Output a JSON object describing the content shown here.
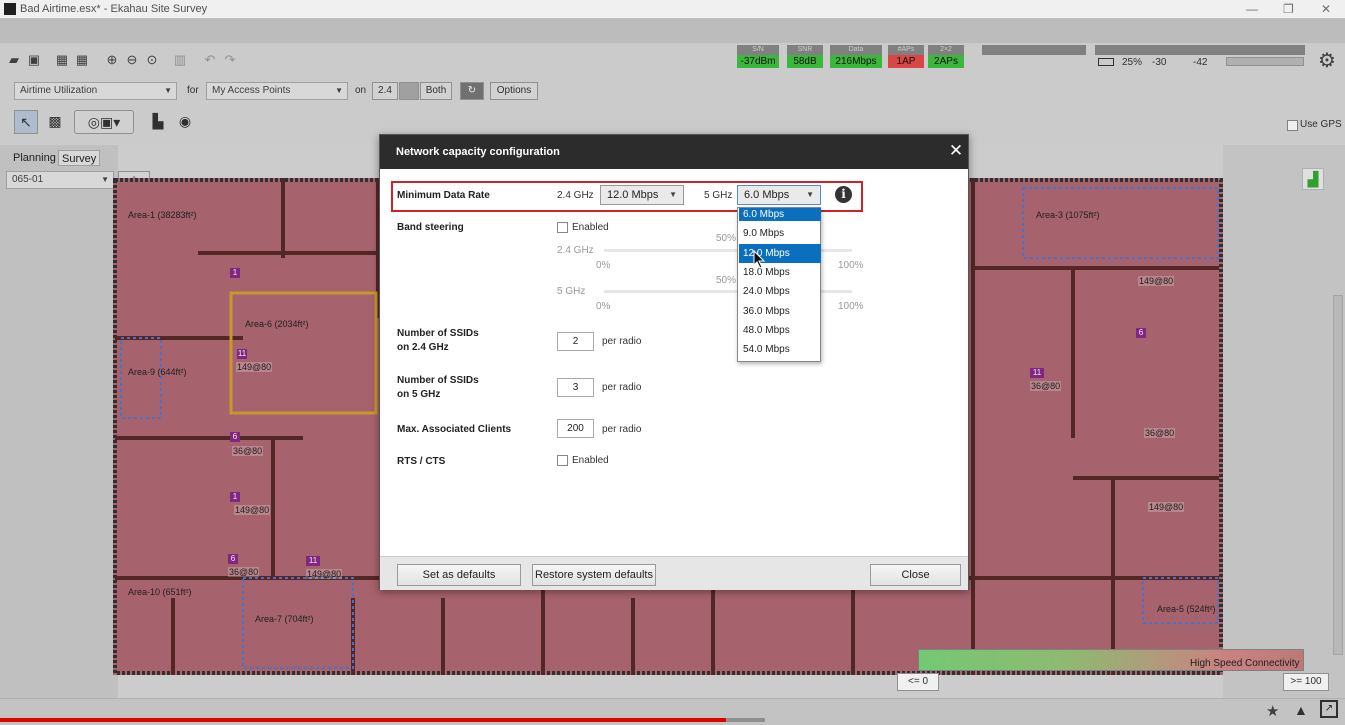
{
  "window": {
    "title": "Bad Airtime.esx* - Ekahau Site Survey",
    "min": "—",
    "max": "❐",
    "close": "✕"
  },
  "stats": [
    {
      "label": "S/N",
      "value": "-37dBm",
      "color": "#3fc43f"
    },
    {
      "label": "SNR",
      "value": "58dB",
      "color": "#3fc43f"
    },
    {
      "label": "Data",
      "value": "216Mbps",
      "color": "#3fc43f"
    },
    {
      "label": "#APs",
      "value": "1AP",
      "color": "#e84a4a"
    },
    {
      "label": "2×2",
      "value": "2APs",
      "color": "#3fc43f"
    }
  ],
  "status_right": {
    "battery": "25%",
    "sig24": "-30",
    "sig5": "-42"
  },
  "toolbar": {
    "view": "Airtime Utilization",
    "for_label": "for",
    "aps": "My Access Points",
    "on_label": "on",
    "band": "2.4",
    "band_both": "Both",
    "options": "Options"
  },
  "use_gps": "Use GPS",
  "tabs": {
    "planning": "Planning",
    "survey": "Survey"
  },
  "floor": "065-01",
  "areas": [
    {
      "label": "Area-1 (38283ft²)"
    },
    {
      "label": "Area-3 (1075ft²)"
    },
    {
      "label": "Area-6 (2034ft²)"
    },
    {
      "label": "Area-9 (644ft²)"
    },
    {
      "label": "Area-10 (651ft²)"
    },
    {
      "label": "Area-7 (704ft²)"
    },
    {
      "label": "Area-5 (524ft²)"
    }
  ],
  "legend": {
    "high": "High Speed Connectivity",
    "low": "<= 0",
    "max": ">= 100"
  },
  "dialog": {
    "title": "Network capacity configuration",
    "close": "✕",
    "min_rate_label": "Minimum Data Rate",
    "ghz24_label": "2.4 GHz",
    "ghz24_value": "12.0 Mbps",
    "ghz5_label": "5 GHz",
    "ghz5_value": "6.0 Mbps",
    "info": "i",
    "band_steering_label": "Band steering",
    "enabled": "Enabled",
    "slider24_label": "2.4 GHz",
    "slider5_label": "5 GHz",
    "pct0": "0%",
    "pct50": "50%",
    "pct100": "100%",
    "ssid24_label_1": "Number of SSIDs",
    "ssid24_label_2": "on 2.4 GHz",
    "ssid24_value": "2",
    "ssid5_label_1": "Number of SSIDs",
    "ssid5_label_2": "on 5 GHz",
    "ssid5_value": "3",
    "per_radio": "per radio",
    "max_clients_label": "Max. Associated Clients",
    "max_clients_value": "200",
    "rts_label": "RTS / CTS",
    "rts_enabled": "Enabled",
    "set_defaults": "Set as defaults",
    "restore_defaults": "Restore system defaults",
    "close_button": "Close"
  },
  "dropdown_options": [
    "6.0 Mbps",
    "9.0 Mbps",
    "12.0 Mbps",
    "18.0 Mbps",
    "24.0 Mbps",
    "36.0 Mbps",
    "48.0 Mbps",
    "54.0 Mbps"
  ],
  "dropdown_highlight_index": 2
}
